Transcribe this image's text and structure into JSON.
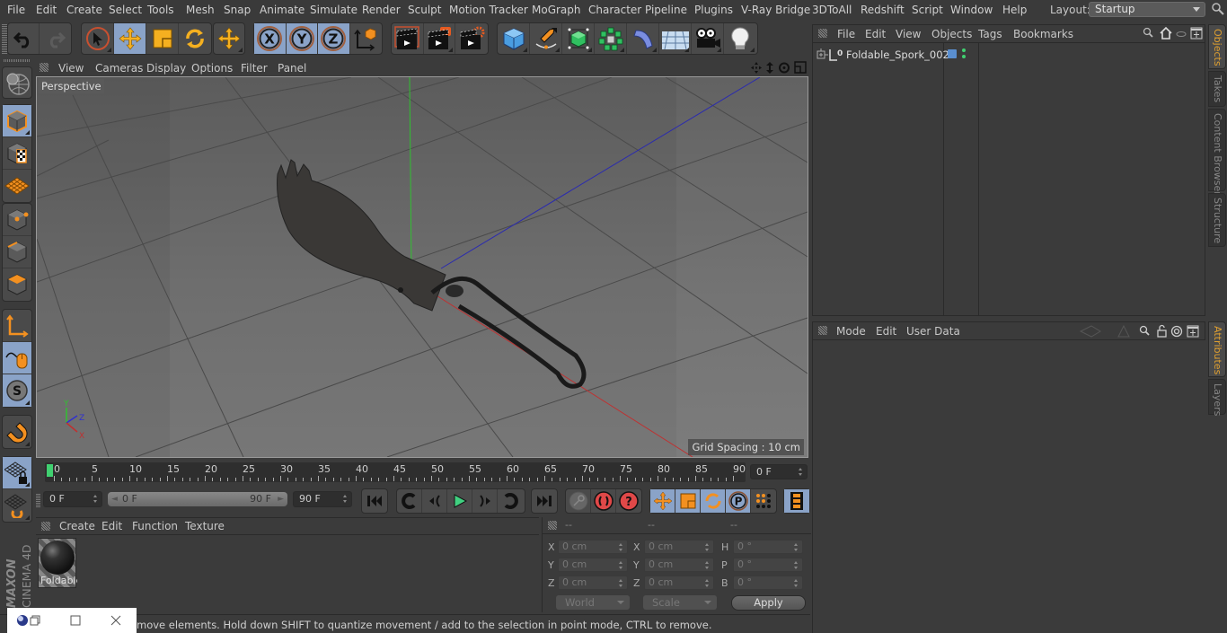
{
  "menubar": {
    "items": [
      "File",
      "Edit",
      "Create",
      "Select",
      "Tools",
      "Mesh",
      "Snap",
      "Animate",
      "Simulate",
      "Render",
      "Sculpt",
      "Motion Tracker",
      "MoGraph",
      "Character",
      "Pipeline",
      "Plugins",
      "V-Ray Bridge",
      "3DToAll",
      "Redshift",
      "Script",
      "Window",
      "Help"
    ],
    "layout_label": "Layout:",
    "layout_value": "Startup"
  },
  "toolbar": {
    "undo": "undo-icon",
    "redo": "redo-icon",
    "tools": [
      "live-selection",
      "move",
      "scale",
      "rotate",
      "last-tool"
    ],
    "active_tool": "move",
    "axis_locks": [
      "X",
      "Y",
      "Z"
    ],
    "coordinate_system": "world-coordinates-icon",
    "render": [
      "render-view",
      "render-picture-viewer",
      "render-settings"
    ],
    "create": [
      "cube",
      "pen",
      "subdivision",
      "cloner",
      "deformer",
      "floor",
      "camera",
      "light"
    ]
  },
  "left_tools": [
    "make-editable",
    "model-mode",
    "texture-mode",
    "workplane-mode",
    "points-mode",
    "edges-mode",
    "polygons-mode",
    "axis-mode",
    "tweak-mode",
    "solo-mode",
    "snapping",
    "workplane-lock",
    "workplane-align"
  ],
  "viewport": {
    "menu": [
      "View",
      "Cameras",
      "Display",
      "Options",
      "Filter",
      "Panel"
    ],
    "camera_label": "Perspective",
    "grid_spacing": "Grid Spacing : 10 cm",
    "axis_labels": {
      "x": "X",
      "y": "Y",
      "z": "Z"
    },
    "axis_colors": {
      "x": "#d03030",
      "y": "#30c030",
      "z": "#3030d0"
    }
  },
  "timeline": {
    "labels": [
      "0",
      "5",
      "10",
      "15",
      "20",
      "25",
      "30",
      "35",
      "40",
      "45",
      "50",
      "55",
      "60",
      "65",
      "70",
      "75",
      "80",
      "85",
      "90"
    ],
    "current_frame": "0 F",
    "playhead_color": "#40d070"
  },
  "playback": {
    "start_field": "0 F",
    "range_start": "0 F",
    "range_end": "90 F",
    "end_field": "90 F"
  },
  "material_manager": {
    "menu": [
      "Create",
      "Edit",
      "Function",
      "Texture"
    ],
    "materials": [
      {
        "name": "Foldable"
      }
    ]
  },
  "coordinates": {
    "headers": [
      "--",
      "--",
      "--"
    ],
    "rows": [
      {
        "l1": "X",
        "v1": "0 cm",
        "l2": "X",
        "v2": "0 cm",
        "l3": "H",
        "v3": "0 °"
      },
      {
        "l1": "Y",
        "v1": "0 cm",
        "l2": "Y",
        "v2": "0 cm",
        "l3": "P",
        "v3": "0 °"
      },
      {
        "l1": "Z",
        "v1": "0 cm",
        "l2": "Z",
        "v2": "0 cm",
        "l3": "B",
        "v3": "0 °"
      }
    ],
    "space_select": "World",
    "mode_select": "Scale",
    "apply_label": "Apply"
  },
  "status": {
    "text": "move elements. Hold down SHIFT to quantize movement / add to the selection in point mode, CTRL to remove."
  },
  "object_manager": {
    "menu": [
      "File",
      "Edit",
      "View",
      "Objects",
      "Tags",
      "Bookmarks"
    ],
    "objects": [
      {
        "name": "Foldable_Spork_002",
        "layer_color": "#5a8fd0"
      }
    ]
  },
  "attributes": {
    "menu": [
      "Mode",
      "Edit",
      "User Data"
    ]
  },
  "side_tabs_top": [
    "Objects",
    "Takes",
    "Content Browser",
    "Structure"
  ],
  "side_tabs_bottom": [
    "Attributes",
    "Layers"
  ],
  "logo": {
    "brand": "MAXON",
    "product": "CINEMA 4D"
  }
}
